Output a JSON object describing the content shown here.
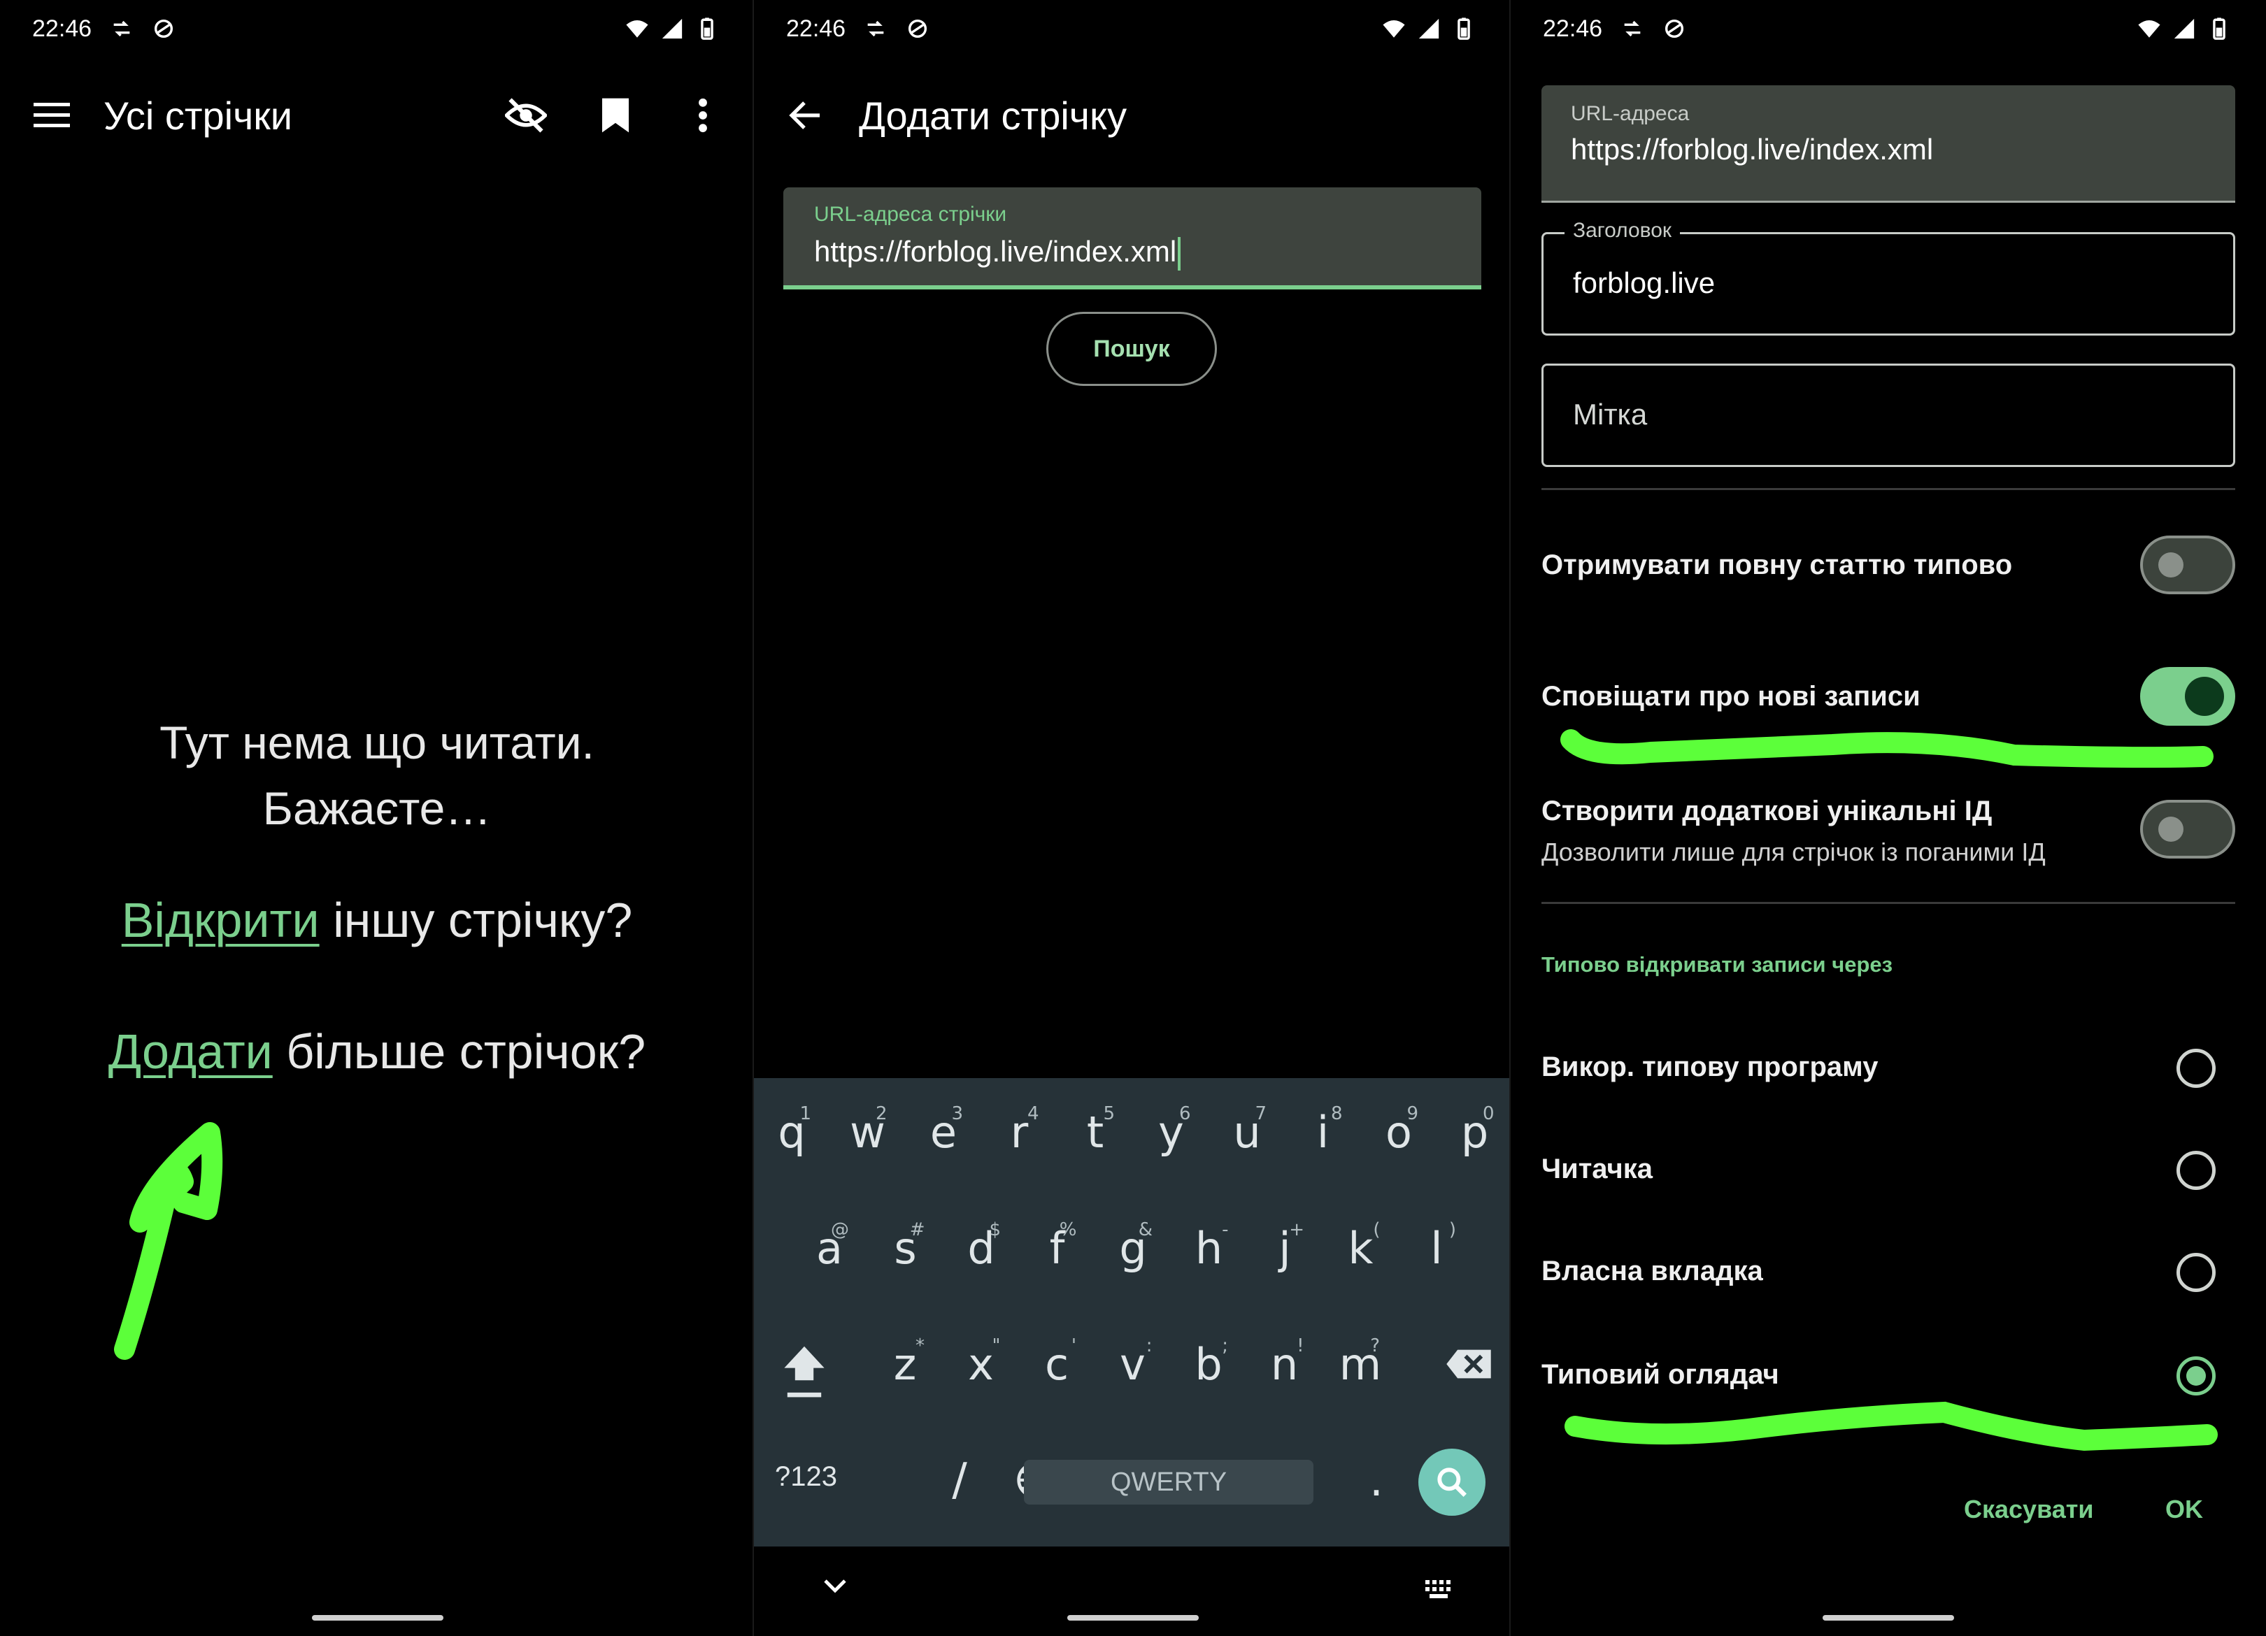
{
  "status": {
    "time": "22:46"
  },
  "screen1": {
    "toolbar": {
      "title": "Усі стрічки"
    },
    "empty_line1": "Тут нема що читати.",
    "empty_line2": "Бажаєте…",
    "open_link": "Відкрити",
    "open_rest": " іншу стрічку?",
    "add_link": "Додати",
    "add_rest": " більше стрічок?"
  },
  "screen2": {
    "toolbar": {
      "title": "Додати стрічку"
    },
    "url_label": "URL-адреса стрічки",
    "url_value": "https://forblog.live/index.xml",
    "search_button": "Пошук",
    "keyboard": {
      "row1": [
        [
          "q",
          "1"
        ],
        [
          "w",
          "2"
        ],
        [
          "e",
          "3"
        ],
        [
          "r",
          "4"
        ],
        [
          "t",
          "5"
        ],
        [
          "y",
          "6"
        ],
        [
          "u",
          "7"
        ],
        [
          "i",
          "8"
        ],
        [
          "o",
          "9"
        ],
        [
          "p",
          "0"
        ]
      ],
      "row2": [
        [
          "a",
          "@"
        ],
        [
          "s",
          "#"
        ],
        [
          "d",
          "$"
        ],
        [
          "f",
          "%"
        ],
        [
          "g",
          "&"
        ],
        [
          "h",
          "-"
        ],
        [
          "j",
          "+"
        ],
        [
          "k",
          "("
        ],
        [
          "l",
          ")"
        ]
      ],
      "row3": [
        [
          "z",
          "*"
        ],
        [
          "x",
          "\""
        ],
        [
          "c",
          "'"
        ],
        [
          "v",
          ":"
        ],
        [
          "b",
          ";"
        ],
        [
          "n",
          "!"
        ],
        [
          "m",
          "?"
        ]
      ],
      "sym_key": "?123",
      "space_label": "QWERTY",
      "period_key": "."
    }
  },
  "screen3": {
    "url_label": "URL-адреса",
    "url_value": "https://forblog.live/index.xml",
    "title_label": "Заголовок",
    "title_value": "forblog.live",
    "tag_placeholder": "Мітка",
    "setting_full_article": "Отримувати повну статтю типово",
    "setting_notify": "Сповіщати про нові записи",
    "setting_unique_ids": "Створити додаткові унікальні ІД",
    "setting_unique_ids_sub": "Дозволити лише для стрічок із поганими ІД",
    "switches": {
      "full_article": false,
      "notify": true,
      "unique_ids": false
    },
    "open_with_header": "Типово відкривати записи через",
    "radio_options": [
      "Викор. типову програму",
      "Читачка",
      "Власна вкладка",
      "Типовий оглядач"
    ],
    "radio_selected_index": 3,
    "cancel_button": "Скасувати",
    "ok_button": "OK"
  },
  "colors": {
    "accent": "#7bcf8d",
    "keyboard_bg": "#263238",
    "field_bg": "#3e443e",
    "annotation": "#5cff3a"
  }
}
